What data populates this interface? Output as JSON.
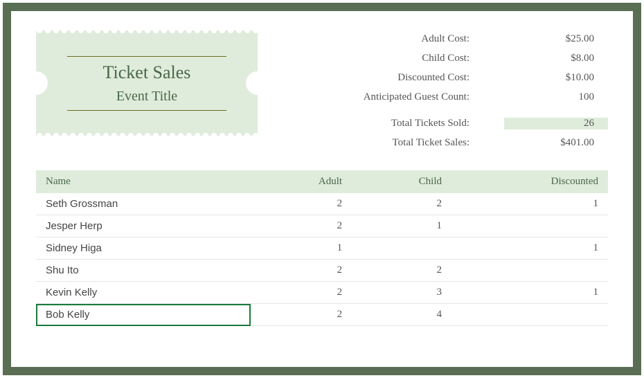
{
  "ticket": {
    "title": "Ticket Sales",
    "subtitle": "Event Title"
  },
  "summary": {
    "rows": [
      {
        "label": "Adult Cost:",
        "value": "$25.00",
        "highlight": false
      },
      {
        "label": "Child Cost:",
        "value": "$8.00",
        "highlight": false
      },
      {
        "label": "Discounted Cost:",
        "value": "$10.00",
        "highlight": false
      },
      {
        "label": "Anticipated Guest Count:",
        "value": "100",
        "highlight": false
      }
    ],
    "totals": [
      {
        "label": "Total Tickets Sold:",
        "value": "26",
        "highlight": true
      },
      {
        "label": "Total Ticket Sales:",
        "value": "$401.00",
        "highlight": false
      }
    ]
  },
  "table": {
    "headers": [
      "Name",
      "Adult",
      "Child",
      "Discounted"
    ],
    "rows": [
      {
        "name": "Seth Grossman",
        "adult": "2",
        "child": "2",
        "discounted": "1",
        "selected": false
      },
      {
        "name": "Jesper Herp",
        "adult": "2",
        "child": "1",
        "discounted": "",
        "selected": false
      },
      {
        "name": "Sidney Higa",
        "adult": "1",
        "child": "",
        "discounted": "1",
        "selected": false
      },
      {
        "name": "Shu Ito",
        "adult": "2",
        "child": "2",
        "discounted": "",
        "selected": false
      },
      {
        "name": "Kevin Kelly",
        "adult": "2",
        "child": "3",
        "discounted": "1",
        "selected": false
      },
      {
        "name": "Bob Kelly",
        "adult": "2",
        "child": "4",
        "discounted": "",
        "selected": true
      }
    ]
  },
  "chart_data": {
    "type": "table",
    "title": "Ticket Sales",
    "columns": [
      "Name",
      "Adult",
      "Child",
      "Discounted"
    ],
    "rows": [
      [
        "Seth Grossman",
        2,
        2,
        1
      ],
      [
        "Jesper Herp",
        2,
        1,
        null
      ],
      [
        "Sidney Higa",
        1,
        null,
        1
      ],
      [
        "Shu Ito",
        2,
        2,
        null
      ],
      [
        "Kevin Kelly",
        2,
        3,
        1
      ],
      [
        "Bob Kelly",
        2,
        4,
        null
      ]
    ],
    "parameters": {
      "adult_cost": 25.0,
      "child_cost": 8.0,
      "discounted_cost": 10.0,
      "anticipated_guest_count": 100
    },
    "totals": {
      "total_tickets_sold": 26,
      "total_ticket_sales": 401.0
    }
  }
}
